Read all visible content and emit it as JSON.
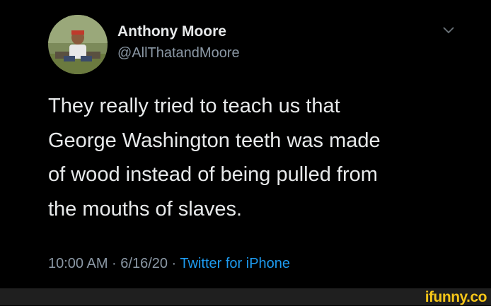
{
  "tweet": {
    "author": {
      "display_name": "Anthony Moore",
      "handle": "@AllThatandMoore"
    },
    "text_lines": [
      "They really tried to teach us that",
      "George Washington teeth was made",
      "of wood instead of being pulled from",
      "the mouths of slaves."
    ],
    "timestamp": "10:00 AM · 6/16/20 · ",
    "source": "Twitter for iPhone",
    "menu_icon": "chevron-down-icon"
  },
  "watermark": {
    "text": "ifunny.co",
    "color": "#f5c518"
  },
  "colors": {
    "background": "#000000",
    "text_primary": "#e7e9ea",
    "text_secondary": "#8b98a5",
    "link": "#1d9bf0"
  }
}
